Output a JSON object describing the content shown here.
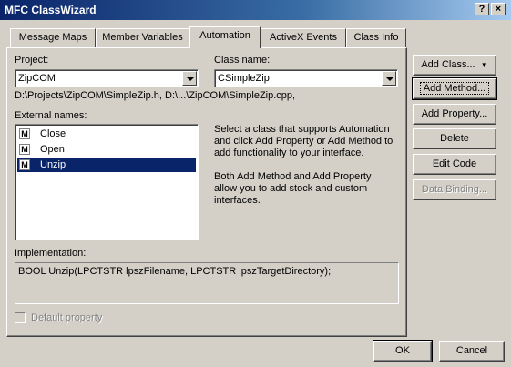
{
  "window": {
    "title": "MFC ClassWizard",
    "help_label": "?",
    "close_label": "×"
  },
  "tabs": [
    {
      "label": "Message Maps"
    },
    {
      "label": "Member Variables"
    },
    {
      "label": "Automation"
    },
    {
      "label": "ActiveX Events"
    },
    {
      "label": "Class Info"
    }
  ],
  "active_tab": "Automation",
  "project": {
    "label": "Project:",
    "value": "ZipCOM"
  },
  "class_name": {
    "label": "Class name:",
    "value": "CSimpleZip"
  },
  "path_text": "D:\\Projects\\ZipCOM\\SimpleZip.h, D:\\...\\ZipCOM\\SimpleZip.cpp,",
  "external_names": {
    "label": "External names:",
    "items": [
      {
        "icon": "M",
        "name": "Close"
      },
      {
        "icon": "M",
        "name": "Open"
      },
      {
        "icon": "M",
        "name": "Unzip"
      }
    ],
    "selected": "Unzip"
  },
  "help_text_1": "Select a class that supports Automation and click Add Property or Add Method to add functionality to your interface.",
  "help_text_2": "Both Add Method and Add Property allow you to add stock and custom interfaces.",
  "implementation": {
    "label": "Implementation:",
    "value": "BOOL Unzip(LPCTSTR lpszFilename, LPCTSTR lpszTargetDirectory);"
  },
  "default_property": {
    "label": "Default property",
    "checked": false,
    "enabled": false
  },
  "buttons": {
    "add_class": "Add Class...",
    "add_method": "Add Method...",
    "add_property": "Add Property...",
    "delete": "Delete",
    "edit_code": "Edit Code",
    "data_binding": "Data Binding...",
    "ok": "OK",
    "cancel": "Cancel"
  }
}
